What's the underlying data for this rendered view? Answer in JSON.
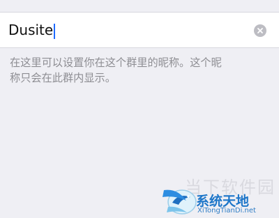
{
  "input": {
    "value": "Dusite",
    "clear_icon": "clear-circle-icon"
  },
  "hint": {
    "line1": "在这里可以设置你在这个群里的昵称。这个昵",
    "line2": "称只会在此群内显示。"
  },
  "watermark": {
    "faded_text": "当下软件园",
    "brand": "系统天地",
    "domain": "XiTongTianDi.net",
    "logo_icon": "bird-globe-logo-icon"
  },
  "colors": {
    "background": "#efeff4",
    "input_background": "#ffffff",
    "hint_text": "#8e8e93",
    "caret": "#1f6bff",
    "clear_button": "#bdbdc3",
    "watermark_blue": "#1d76c9"
  }
}
